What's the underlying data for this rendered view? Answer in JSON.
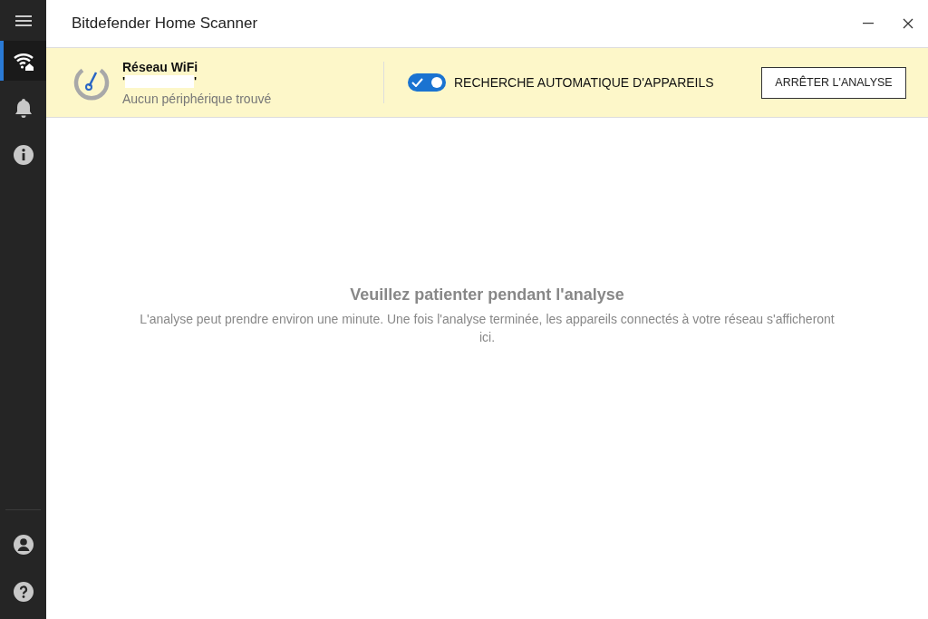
{
  "window": {
    "title": "Bitdefender Home Scanner"
  },
  "sidebar": {
    "items": [
      {
        "kind": "wifi",
        "selected": true
      },
      {
        "kind": "bell",
        "selected": false
      },
      {
        "kind": "info",
        "selected": false
      }
    ],
    "bottom_items": [
      {
        "kind": "account",
        "selected": false
      },
      {
        "kind": "help",
        "selected": false
      }
    ]
  },
  "banner": {
    "network_label": "Réseau WiFi",
    "network_name_quotes": [
      "'",
      "'"
    ],
    "status": "Aucun périphérique trouvé",
    "auto_search": {
      "label": "RECHERCHE AUTOMATIQUE D'APPAREILS",
      "on": true
    },
    "stop_button": "ARRÊTER L'ANALYSE"
  },
  "message": {
    "title": "Veuillez patienter pendant l'analyse",
    "text": "L'analyse peut prendre environ une minute. Une fois l'analyse terminée, les appareils connectés à votre réseau s'afficheront ici."
  }
}
